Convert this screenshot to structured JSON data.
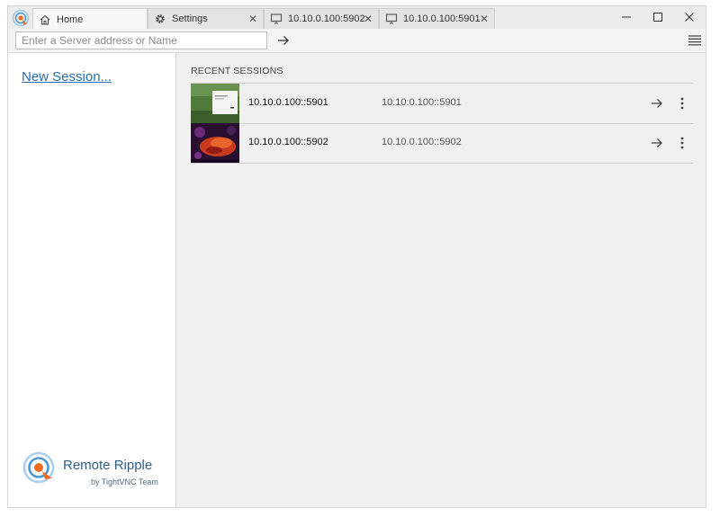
{
  "window": {
    "app_icon": "remote-ripple-logo"
  },
  "tabs": [
    {
      "label": "Home",
      "icon": "home-icon",
      "active": true,
      "closable": false
    },
    {
      "label": "Settings",
      "icon": "gear-icon",
      "active": false,
      "closable": true
    },
    {
      "label": "10.10.0.100:5902",
      "icon": "monitor-icon",
      "active": false,
      "closable": true
    },
    {
      "label": "10.10.0.100:5901",
      "icon": "monitor-icon",
      "active": false,
      "closable": true
    }
  ],
  "address_bar": {
    "placeholder": "Enter a Server address or Name",
    "value": ""
  },
  "sidebar": {
    "new_session_label": "New Session...",
    "brand_name": "Remote Ripple",
    "brand_sub": "by TightVNC Team"
  },
  "recent": {
    "title": "RECENT SESSIONS",
    "sessions": [
      {
        "name": "10.10.0.100::5901",
        "address": "10.10.0.100::5901",
        "thumbnail": "desktop-thumbnail-green"
      },
      {
        "name": "10.10.0.100::5902",
        "address": "10.10.0.100::5902",
        "thumbnail": "desktop-thumbnail-red"
      }
    ]
  },
  "colors": {
    "link": "#2b6cb0",
    "brand_orange": "#f26a21",
    "brand_blue": "#4a9ad8"
  }
}
